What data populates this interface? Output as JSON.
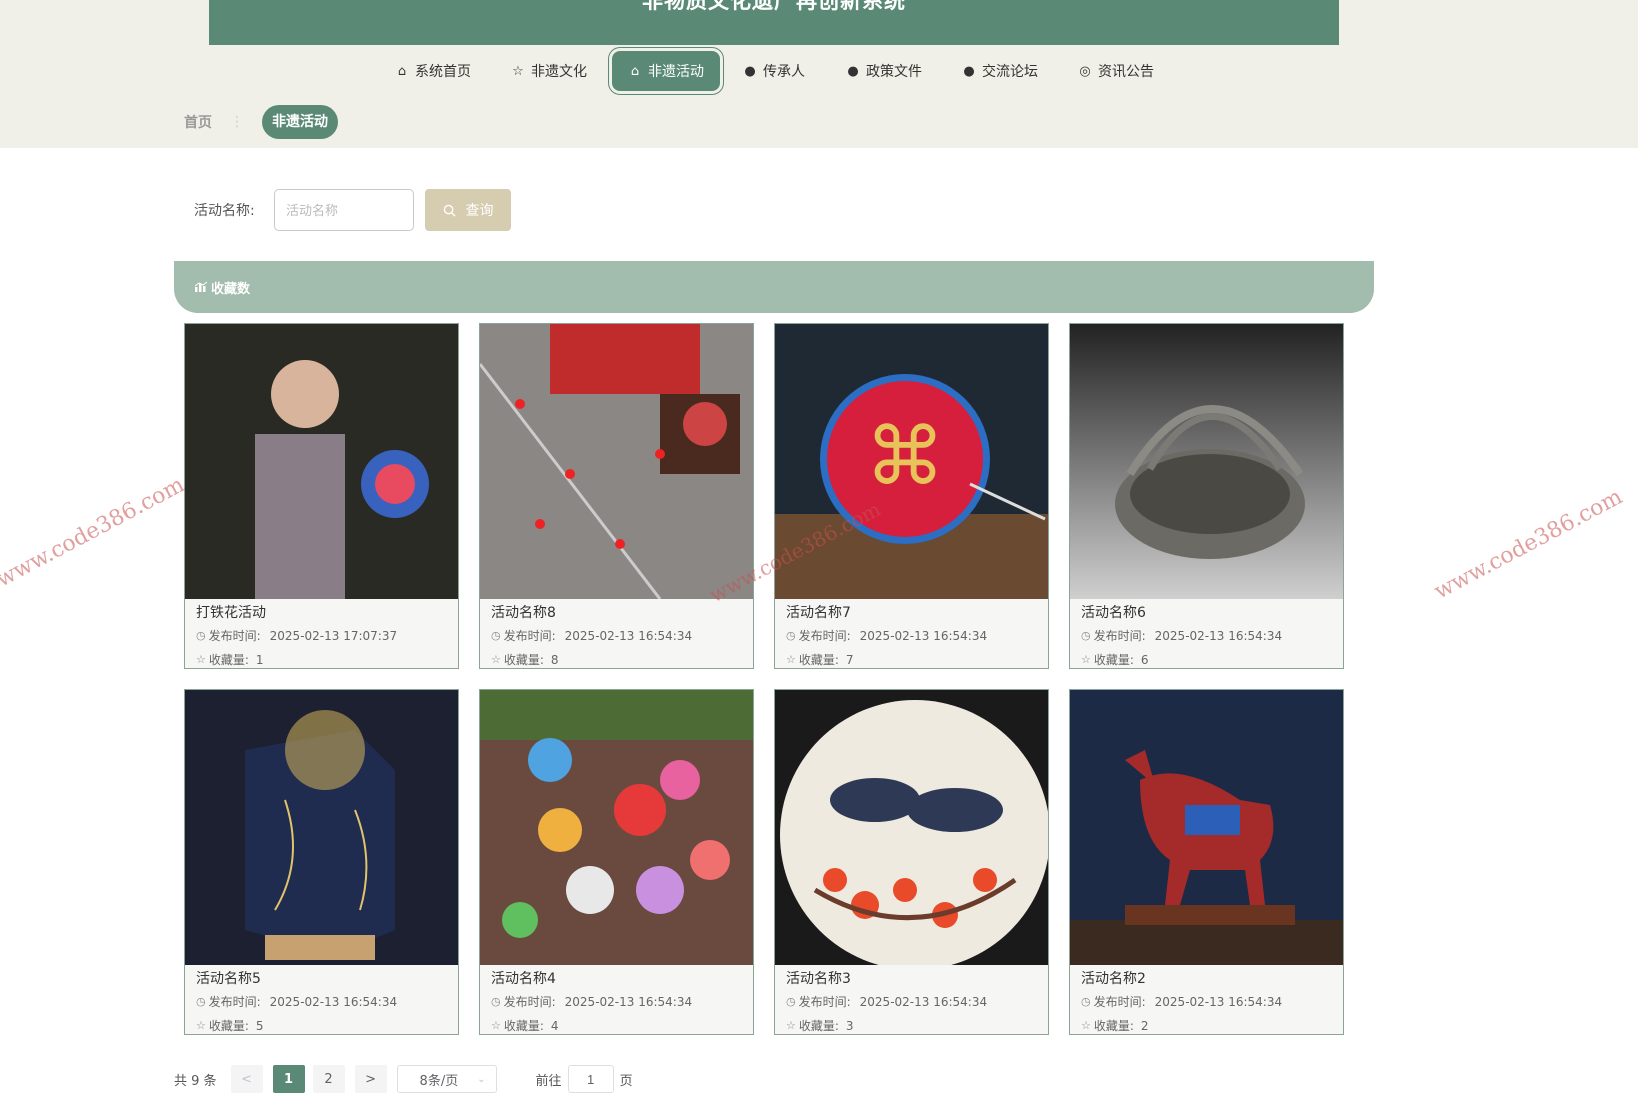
{
  "app": {
    "title": "非物质文化遗产再创新系统"
  },
  "nav": [
    {
      "label": "系统首页",
      "icon": "home-icon",
      "glyph": "⌂"
    },
    {
      "label": "非遗文化",
      "icon": "star-icon",
      "glyph": "☆"
    },
    {
      "label": "非遗活动",
      "icon": "bag-icon",
      "glyph": "⌂",
      "active": true
    },
    {
      "label": "传承人",
      "icon": "exclamation-circle-icon",
      "glyph": "❶"
    },
    {
      "label": "政策文件",
      "icon": "question-circle-icon",
      "glyph": "❷"
    },
    {
      "label": "交流论坛",
      "icon": "info-circle-icon",
      "glyph": "❸"
    },
    {
      "label": "资讯公告",
      "icon": "settings-circle-icon",
      "glyph": "◎"
    }
  ],
  "breadcrumb": {
    "home": "首页",
    "separator": "⋮",
    "current": "非遗活动"
  },
  "search": {
    "label": "活动名称:",
    "placeholder": "活动名称",
    "value": "",
    "button_label": "查询"
  },
  "section": {
    "title": "收藏数",
    "icon": "chart-icon"
  },
  "labels": {
    "publish_time": "发布时间:",
    "favorites": "收藏量:"
  },
  "cards": [
    {
      "name": "打铁花活动",
      "time": "2025-02-13 17:07:37",
      "favorites": "1",
      "theme": "#2a2a24"
    },
    {
      "name": "活动名称8",
      "time": "2025-02-13 16:54:34",
      "favorites": "8",
      "theme": "#8a8784"
    },
    {
      "name": "活动名称7",
      "time": "2025-02-13 16:54:34",
      "favorites": "7",
      "theme": "#1e2933"
    },
    {
      "name": "活动名称6",
      "time": "2025-02-13 16:54:34",
      "favorites": "6",
      "theme": "#3a3a3a"
    },
    {
      "name": "活动名称5",
      "time": "2025-02-13 16:54:34",
      "favorites": "5",
      "theme": "#1c2030"
    },
    {
      "name": "活动名称4",
      "time": "2025-02-13 16:54:34",
      "favorites": "4",
      "theme": "#5d4136"
    },
    {
      "name": "活动名称3",
      "time": "2025-02-13 16:54:34",
      "favorites": "3",
      "theme": "#1a1a1a"
    },
    {
      "name": "活动名称2",
      "time": "2025-02-13 16:54:34",
      "favorites": "2",
      "theme": "#1d2a45"
    }
  ],
  "pagination": {
    "total": "共 9 条",
    "prev": "<",
    "pages": [
      "1",
      "2"
    ],
    "current": "1",
    "next": ">",
    "page_size": "8条/页",
    "jump_prefix": "前往",
    "jump_value": "1",
    "jump_suffix": "页"
  },
  "watermark": "www.code386.com",
  "colors": {
    "primary": "#5a8a76",
    "section": "#a2bcad",
    "button": "#d6ccb0",
    "band": "#f1f0e8"
  }
}
